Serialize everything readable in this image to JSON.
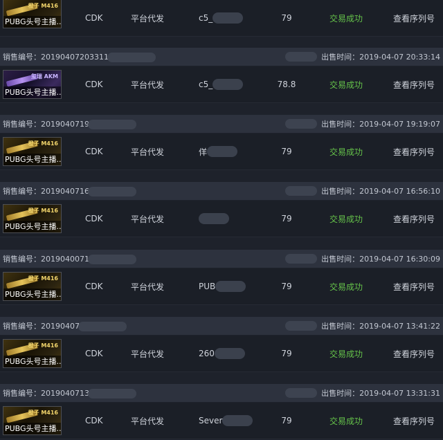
{
  "labels": {
    "sale_no": "销售编号：",
    "sold_time": "出售时间：",
    "type": "CDK",
    "delivery": "平台代发",
    "status": "交易成功",
    "view": "查看序列号"
  },
  "rows": [
    {
      "sale_no": "",
      "sold_time": "",
      "thumb_title": "橙子 M416",
      "thumb_name": "PUBG头号主播...",
      "account": "c5_",
      "price": "79",
      "theme": "gold"
    },
    {
      "sale_no": "20190407203311",
      "sold_time": "2019-04-07 20:33:14",
      "thumb_title": "玺瑞 AKM",
      "thumb_name": "PUBG头号主播...",
      "account": "c5_",
      "price": "78.8",
      "theme": "purple"
    },
    {
      "sale_no": "2019040719",
      "sold_time": "2019-04-07 19:19:07",
      "thumb_title": "橙子 M416",
      "thumb_name": "PUBG头号主播...",
      "account": "佯",
      "price": "79",
      "theme": "gold"
    },
    {
      "sale_no": "2019040716",
      "sold_time": "2019-04-07 16:56:10",
      "thumb_title": "橙子 M416",
      "thumb_name": "PUBG头号主播...",
      "account": "",
      "price": "79",
      "theme": "gold"
    },
    {
      "sale_no": "2019040071",
      "sold_time": "2019-04-07 16:30:09",
      "thumb_title": "橙子 M416",
      "thumb_name": "PUBG头号主播...",
      "account": "PUB",
      "price": "79",
      "theme": "gold"
    },
    {
      "sale_no": "20190407",
      "sold_time": "2019-04-07 13:41:22",
      "thumb_title": "橙子 M416",
      "thumb_name": "PUBG头号主播...",
      "account": "260",
      "price": "79",
      "theme": "gold"
    },
    {
      "sale_no": "2019040713",
      "sold_time": "2019-04-07 13:31:31",
      "thumb_title": "橙子 M416",
      "thumb_name": "PUBG头号主播...",
      "account": "Sever",
      "price": "79",
      "theme": "gold"
    }
  ],
  "colors": {
    "success": "#65c24a",
    "header_bg": "#2d323e",
    "row_bg": "#1b1f27"
  }
}
